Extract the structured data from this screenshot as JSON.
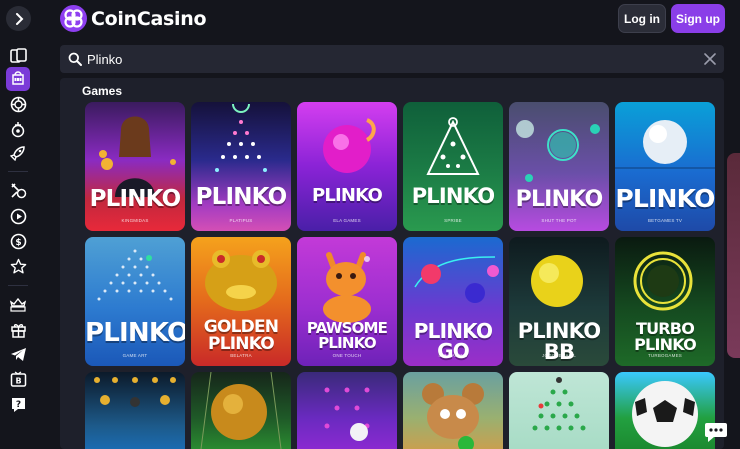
{
  "brand": {
    "name": "CoinCasino",
    "accent": "#8a3ee8"
  },
  "header": {
    "login_label": "Log in",
    "signup_label": "Sign up"
  },
  "sidebar": {
    "items": [
      {
        "icon": "cards-icon"
      },
      {
        "icon": "slot-machine-icon",
        "active": true
      },
      {
        "icon": "poker-chip-icon"
      },
      {
        "icon": "roulette-icon"
      },
      {
        "icon": "rocket-icon"
      },
      {
        "icon": "sports-icon"
      },
      {
        "icon": "play-icon"
      },
      {
        "icon": "coin-icon"
      },
      {
        "icon": "star-icon"
      },
      {
        "icon": "vip-crown-icon"
      },
      {
        "icon": "gift-icon"
      },
      {
        "icon": "telegram-icon"
      },
      {
        "icon": "bitcoin-icon"
      },
      {
        "icon": "help-icon"
      }
    ]
  },
  "search": {
    "value": "Plinko",
    "placeholder": "Search"
  },
  "results": {
    "section_title": "Games",
    "games": [
      {
        "title": "PLINKO",
        "provider": "KINGMIDAS"
      },
      {
        "title": "PLINKO",
        "provider": "PLATIPUS"
      },
      {
        "title": "PLINKO",
        "provider": "ELA GAMES"
      },
      {
        "title": "PLINKO",
        "provider": "SPRIBE"
      },
      {
        "title": "PLINKO",
        "provider": "SHUT THE POT"
      },
      {
        "title": "PLINKO",
        "provider": "BETGAMES TV"
      },
      {
        "title": "PLINKO",
        "provider": "GAME ART"
      },
      {
        "title": "GOLDEN PLINKO",
        "provider": "BELATRA"
      },
      {
        "title": "PAWSOME PLINKO",
        "provider": "ONE TOUCH"
      },
      {
        "title": "PLINKO GO",
        "provider": "512 GAMING"
      },
      {
        "title": "PLINKO BB",
        "provider": "JOGOSBRASIL"
      },
      {
        "title": "TURBO PLINKO",
        "provider": "TURBOGAMES"
      }
    ]
  }
}
